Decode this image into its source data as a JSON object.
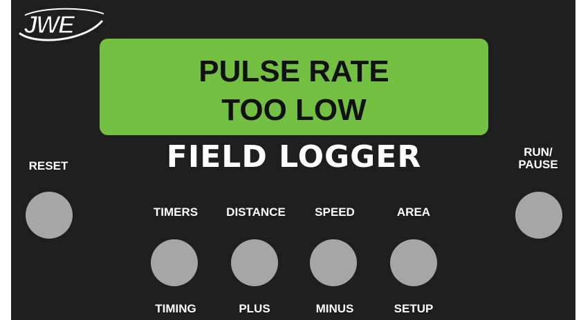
{
  "logo": {
    "text": "JWE"
  },
  "display": {
    "line1": "PULSE RATE",
    "line2": "TOO LOW",
    "background": "#74c043"
  },
  "brand": {
    "title": "FIELD LOGGER"
  },
  "buttons": {
    "reset": {
      "label": "RESET"
    },
    "run_pause": {
      "label_line1": "RUN/",
      "label_line2": "PAUSE"
    },
    "timers": {
      "top_label": "TIMERS",
      "bottom_label": "TIMING"
    },
    "distance": {
      "top_label": "DISTANCE",
      "bottom_label": "PLUS"
    },
    "speed": {
      "top_label": "SPEED",
      "bottom_label": "MINUS"
    },
    "area": {
      "top_label": "AREA",
      "bottom_label": "SETUP"
    }
  },
  "colors": {
    "panel": "#1e1e1e",
    "button": "#a6a6a6",
    "text": "#ffffff"
  }
}
